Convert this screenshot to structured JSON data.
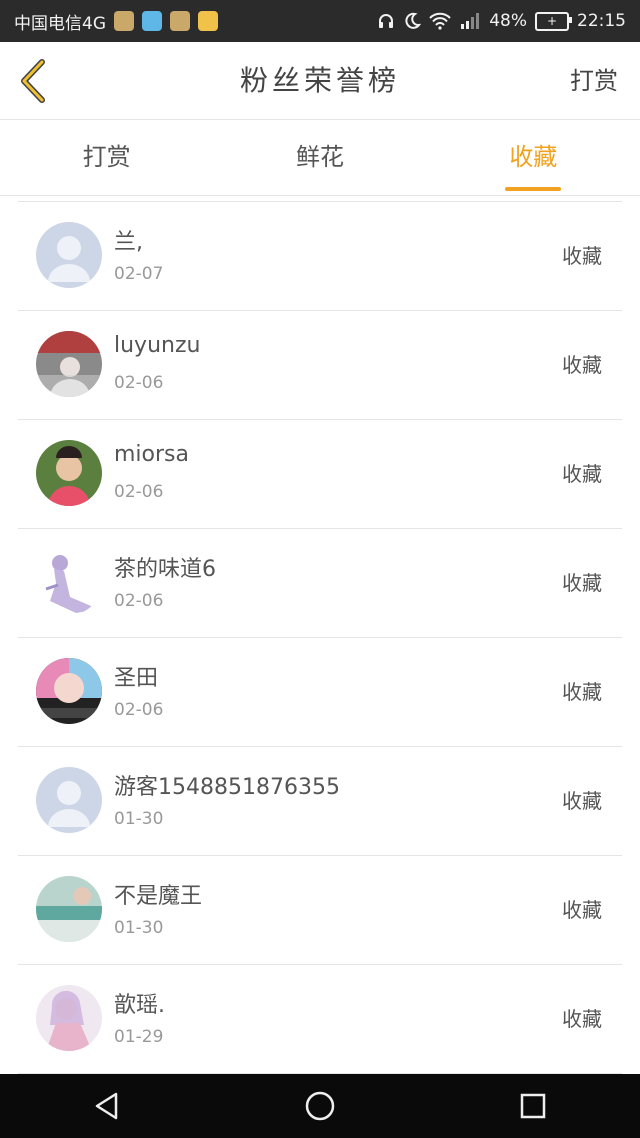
{
  "status_bar": {
    "carrier": "中国电信4G",
    "percent": "48%",
    "time": "22:15",
    "icons": [
      "headset-icon",
      "moon-icon",
      "wifi-icon",
      "signal-icon",
      "battery-icon"
    ]
  },
  "header": {
    "title": "粉丝荣誉榜",
    "action": "打赏"
  },
  "tabs": [
    {
      "label": "打赏",
      "active": false
    },
    {
      "label": "鲜花",
      "active": false
    },
    {
      "label": "收藏",
      "active": true
    }
  ],
  "rows": [
    {
      "name": "兰,",
      "date": "02-07",
      "action": "收藏"
    },
    {
      "name": "luyunzu",
      "date": "02-06",
      "action": "收藏"
    },
    {
      "name": "miorsa",
      "date": "02-06",
      "action": "收藏"
    },
    {
      "name": "茶的味道6",
      "date": "02-06",
      "action": "收藏"
    },
    {
      "name": "圣田",
      "date": "02-06",
      "action": "收藏"
    },
    {
      "name": "游客1548851876355",
      "date": "01-30",
      "action": "收藏"
    },
    {
      "name": "不是魔王",
      "date": "01-30",
      "action": "收藏"
    },
    {
      "name": "歆瑶.",
      "date": "01-29",
      "action": "收藏"
    }
  ],
  "colors": {
    "accent": "#f0a220",
    "status_bar": "#2b2b2b",
    "nav_bar": "#0a0a0a"
  }
}
